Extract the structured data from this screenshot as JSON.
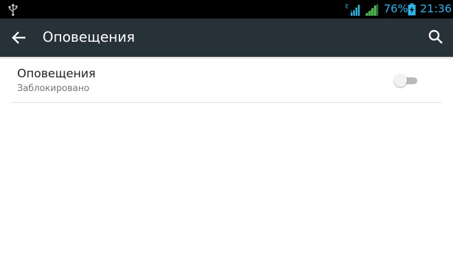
{
  "status_bar": {
    "battery_percent": "76%",
    "time": "21:36",
    "network_type": "E",
    "icons": [
      "usb-icon",
      "signal-e-icon",
      "signal-icon",
      "battery-charging-icon"
    ],
    "accent_color": "#33b5e5"
  },
  "action_bar": {
    "title": "Оповещения",
    "back_icon": "arrow-back-icon",
    "search_icon": "search-icon",
    "background": "#263238"
  },
  "settings": {
    "items": [
      {
        "title": "Оповещения",
        "subtitle": "Заблокировано",
        "toggle_on": false
      }
    ]
  }
}
